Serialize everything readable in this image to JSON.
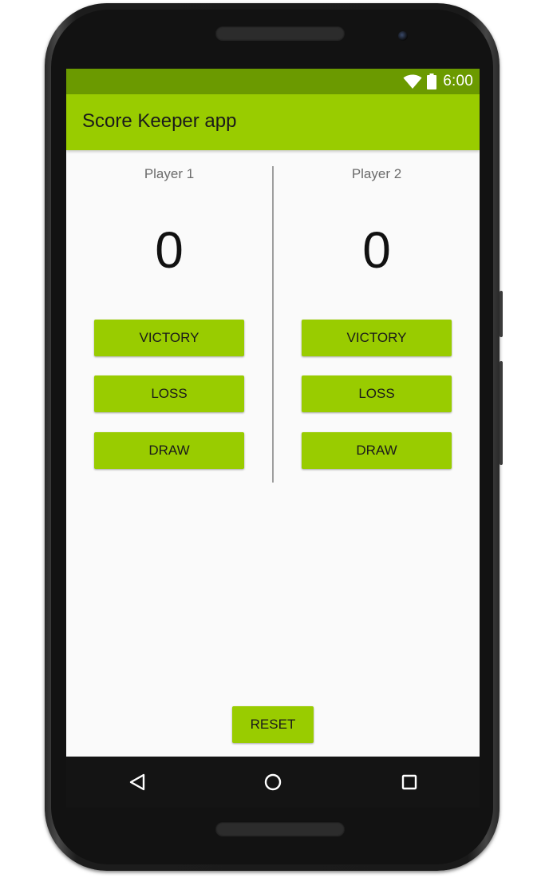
{
  "status_bar": {
    "time": "6:00",
    "icons": [
      "wifi-icon",
      "battery-icon"
    ]
  },
  "app_bar": {
    "title": "Score Keeper app"
  },
  "players": [
    {
      "name": "Player 1",
      "score": "0",
      "buttons": {
        "victory": "VICTORY",
        "loss": "LOSS",
        "draw": "DRAW"
      }
    },
    {
      "name": "Player 2",
      "score": "0",
      "buttons": {
        "victory": "VICTORY",
        "loss": "LOSS",
        "draw": "DRAW"
      }
    }
  ],
  "reset_label": "RESET",
  "nav_bar": {
    "icons": [
      "back-icon",
      "home-icon",
      "recents-icon"
    ]
  },
  "colors": {
    "status_bar": "#6b9a00",
    "accent": "#99cc00",
    "screen_background": "#fafafa"
  }
}
